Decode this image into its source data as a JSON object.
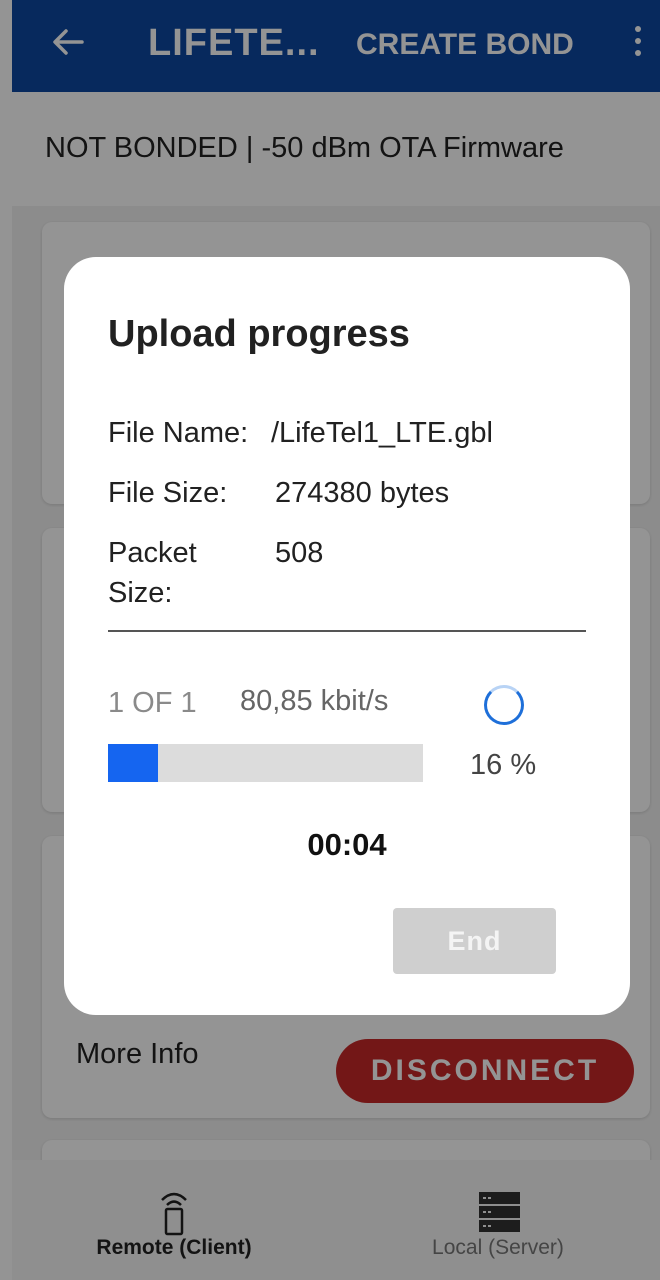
{
  "colors": {
    "appbar": "#0d47a1",
    "disconnect": "#c62828",
    "progress": "#1565f0",
    "spinner": "#1e6fd9",
    "end_button": "#cfcfcf"
  },
  "appbar": {
    "back_icon": "arrow-left-icon",
    "title": "LIFETE...",
    "create_bond": "CREATE BOND",
    "menu_icon": "more-vert-icon"
  },
  "status": {
    "text": "NOT BONDED | -50 dBm OTA Firmware"
  },
  "content": {
    "more_info": "More Info",
    "disconnect": "DISCONNECT"
  },
  "bottom_nav": {
    "items": [
      {
        "label": "Remote (Client)",
        "icon": "remote-device-icon",
        "selected": true
      },
      {
        "label": "Local (Server)",
        "icon": "server-icon",
        "selected": false
      }
    ]
  },
  "dialog": {
    "title": "Upload progress",
    "file_name_label": "File Name:",
    "file_name": "/LifeTel1_LTE.gbl",
    "file_size_label": "File Size:",
    "file_size": "274380 bytes",
    "packet_size_label": "Packet Size:",
    "packet_size": "508",
    "count": "1 OF 1",
    "speed": "80,85 kbit/s",
    "spinner_icon": "loading-spinner-icon",
    "progress_percent": 16,
    "progress_label": "16 %",
    "timer": "00:04",
    "end_button": "End"
  }
}
